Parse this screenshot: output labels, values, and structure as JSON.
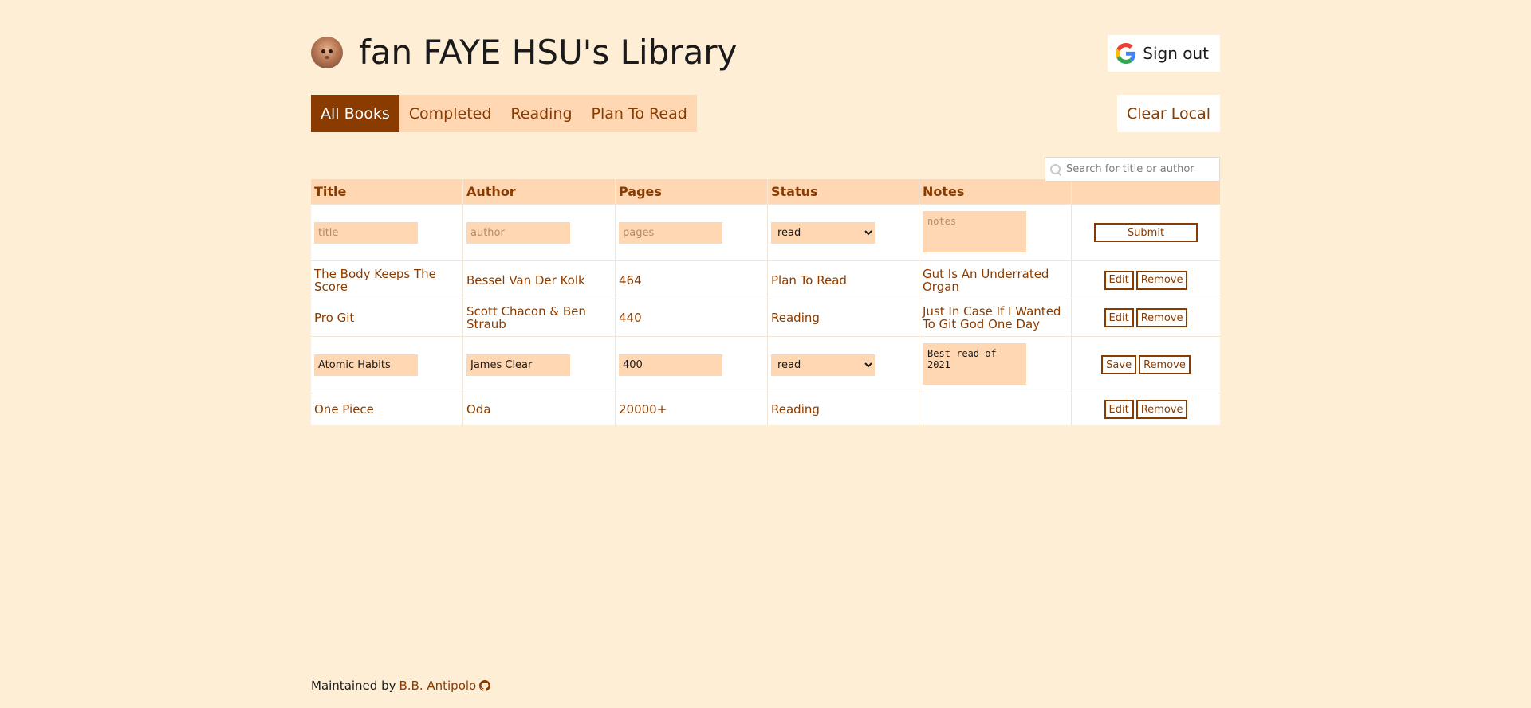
{
  "header": {
    "title": "fan FAYE HSU's Library",
    "signout_label": "Sign out",
    "avatar_icon": "user-avatar-icon",
    "signout_icon": "google-icon"
  },
  "tabs": [
    {
      "label": "All Books",
      "active": true
    },
    {
      "label": "Completed",
      "active": false
    },
    {
      "label": "Reading",
      "active": false
    },
    {
      "label": "Plan To Read",
      "active": false
    }
  ],
  "clear_local_label": "Clear Local",
  "search": {
    "placeholder": "Search for title or author",
    "icon": "search-icon"
  },
  "table": {
    "columns": [
      "Title",
      "Author",
      "Pages",
      "Status",
      "Notes",
      ""
    ],
    "new_row": {
      "title_placeholder": "title",
      "author_placeholder": "author",
      "pages_placeholder": "pages",
      "status_value": "read",
      "notes_placeholder": "notes",
      "submit_label": "Submit"
    },
    "rows": [
      {
        "title": "The Body Keeps The Score",
        "author": "Bessel Van Der Kolk",
        "pages": "464",
        "status": "Plan To Read",
        "notes": "Gut Is An Underrated Organ",
        "edit_label": "Edit",
        "remove_label": "Remove"
      },
      {
        "title": "Pro Git",
        "author": "Scott Chacon & Ben Straub",
        "pages": "440",
        "status": "Reading",
        "notes": "Just In Case If I Wanted To Git God One Day",
        "edit_label": "Edit",
        "remove_label": "Remove"
      }
    ],
    "editing_row": {
      "title": "Atomic Habits",
      "author": "James Clear",
      "pages": "400",
      "status": "read",
      "notes": "Best read of 2021",
      "save_label": "Save",
      "remove_label": "Remove"
    },
    "last_row": {
      "title": "One Piece",
      "author": "Oda",
      "pages": "20000+",
      "status": "Reading",
      "notes": "",
      "edit_label": "Edit",
      "remove_label": "Remove"
    }
  },
  "status_options": [
    "read"
  ],
  "footer": {
    "prefix": "Maintained by",
    "author_link": "B.B. Antipolo",
    "icon": "github-icon"
  },
  "colors": {
    "background": "#ffeed6",
    "accent": "#8a3c00",
    "accent_light": "#ffd7b3"
  }
}
